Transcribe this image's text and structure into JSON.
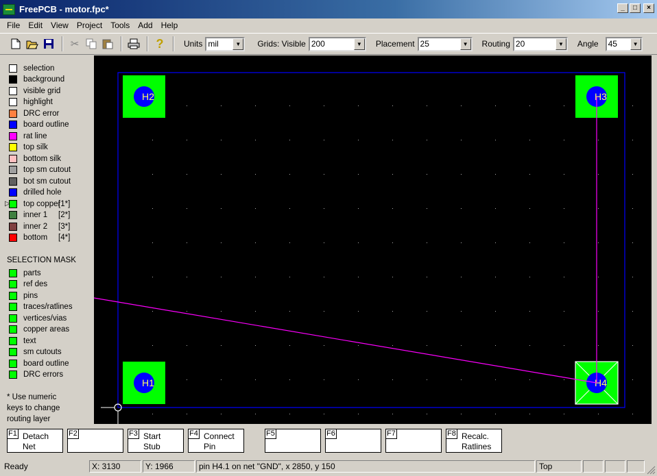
{
  "window": {
    "title": "FreePCB - motor.fpc*",
    "minimize": "_",
    "maximize": "□",
    "close": "×"
  },
  "menu": [
    "File",
    "Edit",
    "View",
    "Project",
    "Tools",
    "Add",
    "Help"
  ],
  "toolbar": {
    "units_label": "Units",
    "units_value": "mil",
    "grids_label": "Grids: Visible",
    "grids_value": "200",
    "placement_label": "Placement",
    "placement_value": "25",
    "routing_label": "Routing",
    "routing_value": "20",
    "angle_label": "Angle",
    "angle_value": "45"
  },
  "layers": [
    {
      "label": "selection",
      "num": "",
      "color": "#ffffff"
    },
    {
      "label": "background",
      "num": "",
      "color": "#000000"
    },
    {
      "label": "visible grid",
      "num": "",
      "color": "#ffffff"
    },
    {
      "label": "highlight",
      "num": "",
      "color": "#ffffff"
    },
    {
      "label": "DRC error",
      "num": "",
      "color": "#ff8040"
    },
    {
      "label": "board outline",
      "num": "",
      "color": "#0000ff"
    },
    {
      "label": "rat line",
      "num": "",
      "color": "#ff00ff"
    },
    {
      "label": "top silk",
      "num": "",
      "color": "#ffff00"
    },
    {
      "label": "bottom silk",
      "num": "",
      "color": "#ffc0c0"
    },
    {
      "label": "top sm cutout",
      "num": "",
      "color": "#a0a0a0"
    },
    {
      "label": "bot sm cutout",
      "num": "",
      "color": "#606060"
    },
    {
      "label": "drilled hole",
      "num": "",
      "color": "#0000ff"
    },
    {
      "label": "top copper",
      "num": "[1*]",
      "color": "#00ff00"
    },
    {
      "label": "inner 1",
      "num": "[2*]",
      "color": "#408040"
    },
    {
      "label": "inner 2",
      "num": "[3*]",
      "color": "#804040"
    },
    {
      "label": "bottom",
      "num": "[4*]",
      "color": "#ff0000"
    }
  ],
  "selection_mask": {
    "title": "SELECTION MASK",
    "items": [
      "parts",
      "ref des",
      "pins",
      "traces/ratlines",
      "vertices/vias",
      "copper areas",
      "text",
      "sm cutouts",
      "board outline",
      "DRC errors"
    ],
    "color": "#00ff00"
  },
  "note": [
    "* Use numeric",
    "keys to change",
    "routing layer"
  ],
  "parts": [
    {
      "ref": "H1"
    },
    {
      "ref": "H2"
    },
    {
      "ref": "H3"
    },
    {
      "ref": "H4"
    }
  ],
  "function_keys": [
    {
      "key": "F1",
      "label": "Detach\nNet"
    },
    {
      "key": "F2",
      "label": ""
    },
    {
      "key": "F3",
      "label": "Start\nStub"
    },
    {
      "key": "F4",
      "label": "Connect\nPin"
    },
    {
      "key": "F5",
      "label": ""
    },
    {
      "key": "F6",
      "label": ""
    },
    {
      "key": "F7",
      "label": ""
    },
    {
      "key": "F8",
      "label": "Recalc.\nRatlines"
    }
  ],
  "status": {
    "ready": "Ready",
    "x": "X: 3130",
    "y": "Y: 1966",
    "info": "pin H4.1 on net \"GND\", x 2850, y 150",
    "layer": "Top"
  }
}
